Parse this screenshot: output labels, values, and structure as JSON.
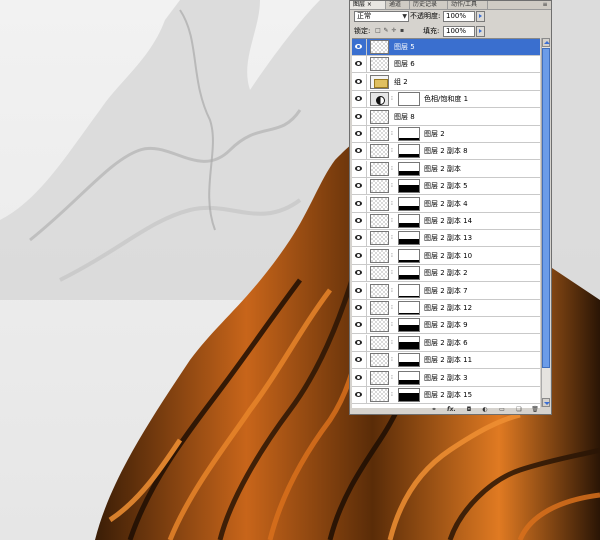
{
  "panel": {
    "tabs": [
      "图层 ×",
      "通道",
      "历史记录",
      "动作/工具"
    ],
    "blend_mode": "正常",
    "opacity_label": "不透明度:",
    "opacity_value": "100%",
    "lock_label": "锁定:",
    "fill_label": "填充:",
    "fill_value": "100%"
  },
  "layers": [
    {
      "name": "图层 5",
      "thumb": "transparent",
      "mask_fill": null,
      "selected": true
    },
    {
      "name": "图层 6",
      "thumb": "transparent",
      "mask_fill": null,
      "selected": false
    },
    {
      "name": "组 2",
      "thumb": "group",
      "mask_fill": null,
      "selected": false
    },
    {
      "name": "色相/饱和度 1",
      "thumb": "adjust",
      "mask_fill": 0,
      "selected": false
    },
    {
      "name": "图层 8",
      "thumb": "transparent",
      "mask_fill": null,
      "selected": false
    },
    {
      "name": "图层 2",
      "thumb": "transparent",
      "mask_fill": 0.15,
      "selected": false
    },
    {
      "name": "图层 2 副本 8",
      "thumb": "transparent",
      "mask_fill": 0.25,
      "selected": false
    },
    {
      "name": "图层 2 副本",
      "thumb": "transparent",
      "mask_fill": 0.3,
      "selected": false
    },
    {
      "name": "图层 2 副本 5",
      "thumb": "transparent",
      "mask_fill": 0.6,
      "selected": false
    },
    {
      "name": "图层 2 副本 4",
      "thumb": "transparent",
      "mask_fill": 0.35,
      "selected": false
    },
    {
      "name": "图层 2 副本 14",
      "thumb": "transparent",
      "mask_fill": 0.3,
      "selected": false
    },
    {
      "name": "图层 2 副本 13",
      "thumb": "transparent",
      "mask_fill": 0.4,
      "selected": false
    },
    {
      "name": "图层 2 副本 10",
      "thumb": "transparent",
      "mask_fill": 0.2,
      "selected": false
    },
    {
      "name": "图层 2 副本 2",
      "thumb": "transparent",
      "mask_fill": 0.3,
      "selected": false
    },
    {
      "name": "图层 2 副本 7",
      "thumb": "transparent",
      "mask_fill": 0.1,
      "selected": false
    },
    {
      "name": "图层 2 副本 12",
      "thumb": "transparent",
      "mask_fill": 0.1,
      "selected": false
    },
    {
      "name": "图层 2 副本 9",
      "thumb": "transparent",
      "mask_fill": 0.5,
      "selected": false
    },
    {
      "name": "图层 2 副本 6",
      "thumb": "transparent",
      "mask_fill": 0.6,
      "selected": false
    },
    {
      "name": "图层 2 副本 11",
      "thumb": "transparent",
      "mask_fill": 0.3,
      "selected": false
    },
    {
      "name": "图层 2 副本 3",
      "thumb": "transparent",
      "mask_fill": 0.35,
      "selected": false
    },
    {
      "name": "图层 2 副本 15",
      "thumb": "transparent",
      "mask_fill": 0.7,
      "selected": false
    }
  ],
  "colors": {
    "selection": "#3a6fcf",
    "orange": "#d9701c",
    "dark_brown": "#2a1505",
    "background": "#ececec"
  },
  "icons": [
    "eye-icon",
    "link-icon",
    "fx-icon",
    "mask-icon",
    "adjustment-icon",
    "folder-icon",
    "new-layer-icon",
    "trash-icon"
  ]
}
